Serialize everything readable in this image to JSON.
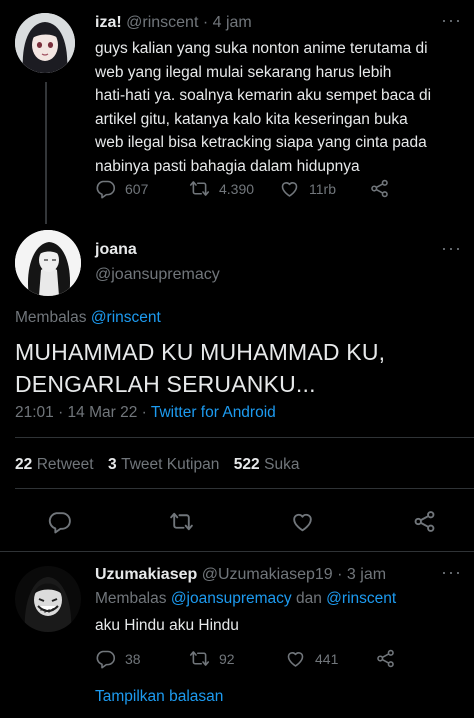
{
  "tweet1": {
    "name": "iza!",
    "handle": "@rinscent",
    "time": "· 4 jam",
    "lines": [
      "guys kalian yang suka nonton anime terutama di",
      "web yang ilegal mulai sekarang harus lebih",
      "hati-hati ya. soalnya kemarin aku sempet baca di",
      "artikel gitu, katanya kalo kita keseringan buka",
      "web ilegal bisa ketracking siapa yang cinta pada",
      "nabinya pasti bahagia dalam hidupnya"
    ],
    "replies": "607",
    "retweets": "4.390",
    "likes": "11rb"
  },
  "main_tweet": {
    "name": "joana",
    "handle": "@joansupremacy",
    "replying_prefix": "Membalas",
    "replying_to": "@rinscent",
    "lines": [
      "MUHAMMAD KU MUHAMMAD KU,",
      "DENGARLAH SERUANKU..."
    ],
    "timestamp": "21:01 · 14 Mar 22 ·",
    "source": "Twitter for Android",
    "retweet_count": "22",
    "retweet_label": "Retweet",
    "quote_count": "3",
    "quote_label": "Tweet Kutipan",
    "like_count": "522",
    "like_label": "Suka"
  },
  "reply": {
    "name": "Uzumakiasep",
    "handle": "@Uzumakiasep19",
    "time": "· 3 jam",
    "replying_prefix": "Membalas",
    "replying_to_1": "@joansupremacy",
    "replying_joiner": "dan",
    "replying_to_2": "@rinscent",
    "text": "aku Hindu aku Hindu",
    "replies": "38",
    "retweets": "92",
    "likes": "441",
    "show_replies": "Tampilkan balasan"
  },
  "colors": {
    "background": "#000000",
    "text": "#e7e9ea",
    "muted": "#71767b",
    "link": "#1d9bf0",
    "divider": "#2f3336"
  },
  "icons": [
    "more-icon",
    "reply-icon",
    "retweet-icon",
    "like-icon",
    "share-icon"
  ]
}
